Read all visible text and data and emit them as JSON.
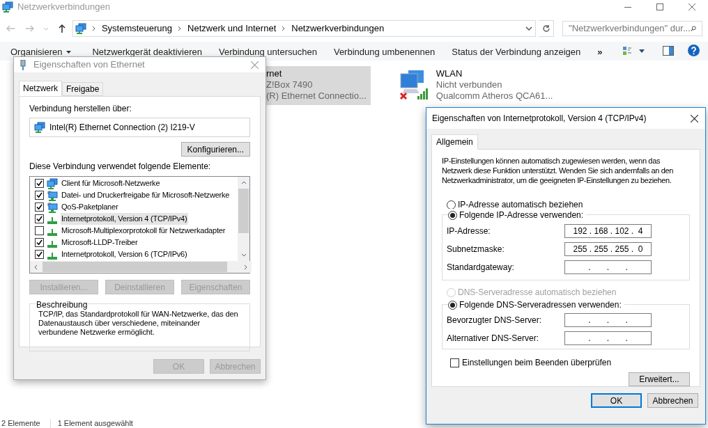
{
  "window": {
    "title": "Netzwerkverbindungen",
    "breadcrumb": [
      "Systemsteuerung",
      "Netzwerk und Internet",
      "Netzwerkverbindungen"
    ],
    "search": {
      "placeholder": "\"Netzwerkverbindungen\" dur..."
    }
  },
  "toolbar": {
    "items": [
      {
        "label": "Organisieren",
        "kind": "menu"
      },
      {
        "label": "Netzwerkgerät deaktivieren",
        "kind": "action"
      },
      {
        "label": "Verbindung untersuchen",
        "kind": "action"
      },
      {
        "label": "Verbindung umbenennen",
        "kind": "action"
      },
      {
        "label": "Status der Verbindung anzeigen",
        "kind": "action"
      },
      {
        "label": "»",
        "kind": "more"
      }
    ]
  },
  "connections": [
    {
      "name": "rnet",
      "status": "Z!Box 7490",
      "adapter": "(R) Ethernet Connectio...",
      "selected": true,
      "kind": "covered"
    },
    {
      "name": "WLAN",
      "status": "Nicht verbunden",
      "adapter": "Qualcomm Atheros QCA61...",
      "selected": false,
      "kind": "wireless"
    }
  ],
  "status_bar": [
    "2 Elemente",
    "1 Element ausgewählt"
  ],
  "ethernet_dialog": {
    "title": "Eigenschaften von Ethernet",
    "tabs": [
      {
        "label": "Netzwerk",
        "selected": true
      },
      {
        "label": "Freigabe",
        "selected": false
      }
    ],
    "connect_label": "Verbindung herstellen über:",
    "adapter": "Intel(R) Ethernet Connection (2) I219-V",
    "configure_button": "Konfigurieren...",
    "elements_label": "Diese Verbindung verwendet folgende Elemente:",
    "elements": [
      {
        "label": "Client für Microsoft-Netzwerke",
        "checked": true,
        "selected": false,
        "kind": "client"
      },
      {
        "label": "Datei- und Druckerfreigabe für Microsoft-Netzwerke",
        "checked": true,
        "selected": false,
        "kind": "service"
      },
      {
        "label": "QoS-Paketplaner",
        "checked": true,
        "selected": false,
        "kind": "service"
      },
      {
        "label": "Internetprotokoll, Version 4 (TCP/IPv4)",
        "checked": true,
        "selected": true,
        "kind": "protocol"
      },
      {
        "label": "Microsoft-Multiplexorprotokoll für Netzwerkadapter",
        "checked": false,
        "selected": false,
        "kind": "protocol"
      },
      {
        "label": "Microsoft-LLDP-Treiber",
        "checked": true,
        "selected": false,
        "kind": "protocol"
      },
      {
        "label": "Internetprotokoll, Version 6 (TCP/IPv6)",
        "checked": true,
        "selected": false,
        "kind": "protocol"
      }
    ],
    "buttons": [
      {
        "label": "Installieren...",
        "disabled": true
      },
      {
        "label": "Deinstallieren",
        "disabled": true
      },
      {
        "label": "Eigenschaften",
        "disabled": true
      }
    ],
    "description": {
      "title": "Beschreibung",
      "text": "TCP/IP, das Standardprotokoll für WAN-Netzwerke, das den Datenaustausch über verschiedene, miteinander verbundene Netzwerke ermöglicht."
    },
    "footer": [
      {
        "label": "OK",
        "disabled": true
      },
      {
        "label": "Abbrechen",
        "disabled": true
      }
    ]
  },
  "ipv4_dialog": {
    "title": "Eigenschaften von Internetprotokoll, Version 4 (TCP/IPv4)",
    "tabs": [
      {
        "label": "Allgemein",
        "selected": true
      }
    ],
    "intro": "IP-Einstellungen können automatisch zugewiesen werden, wenn das Netzwerk diese Funktion unterstützt. Wenden Sie sich andernfalls an den Netzwerkadministrator, um die geeigneten IP-Einstellungen zu beziehen.",
    "ip_auto": {
      "label": "IP-Adresse automatisch beziehen",
      "selected": false,
      "disabled": false
    },
    "ip_manual": {
      "label": "Folgende IP-Adresse verwenden:",
      "selected": true,
      "disabled": false
    },
    "ip_fields": [
      {
        "label": "IP-Adresse:",
        "value": "192 . 168 . 102 .  4"
      },
      {
        "label": "Subnetzmaske:",
        "value": "255 . 255 . 255 .  0"
      },
      {
        "label": "Standardgateway:",
        "value": ".       .       ."
      }
    ],
    "dns_auto": {
      "label": "DNS-Serveradresse automatisch beziehen",
      "selected": false,
      "disabled": true
    },
    "dns_manual": {
      "label": "Folgende DNS-Serveradressen verwenden:",
      "selected": true,
      "disabled": false
    },
    "dns_fields": [
      {
        "label": "Bevorzugter DNS-Server:",
        "value": ".       .       ."
      },
      {
        "label": "Alternativer DNS-Server:",
        "value": ".       .       ."
      }
    ],
    "validate": {
      "label": "Einstellungen beim Beenden überprüfen",
      "checked": false
    },
    "advanced_button": "Erweitert...",
    "footer": [
      {
        "label": "OK",
        "default": true
      },
      {
        "label": "Abbrechen",
        "default": false
      }
    ]
  }
}
